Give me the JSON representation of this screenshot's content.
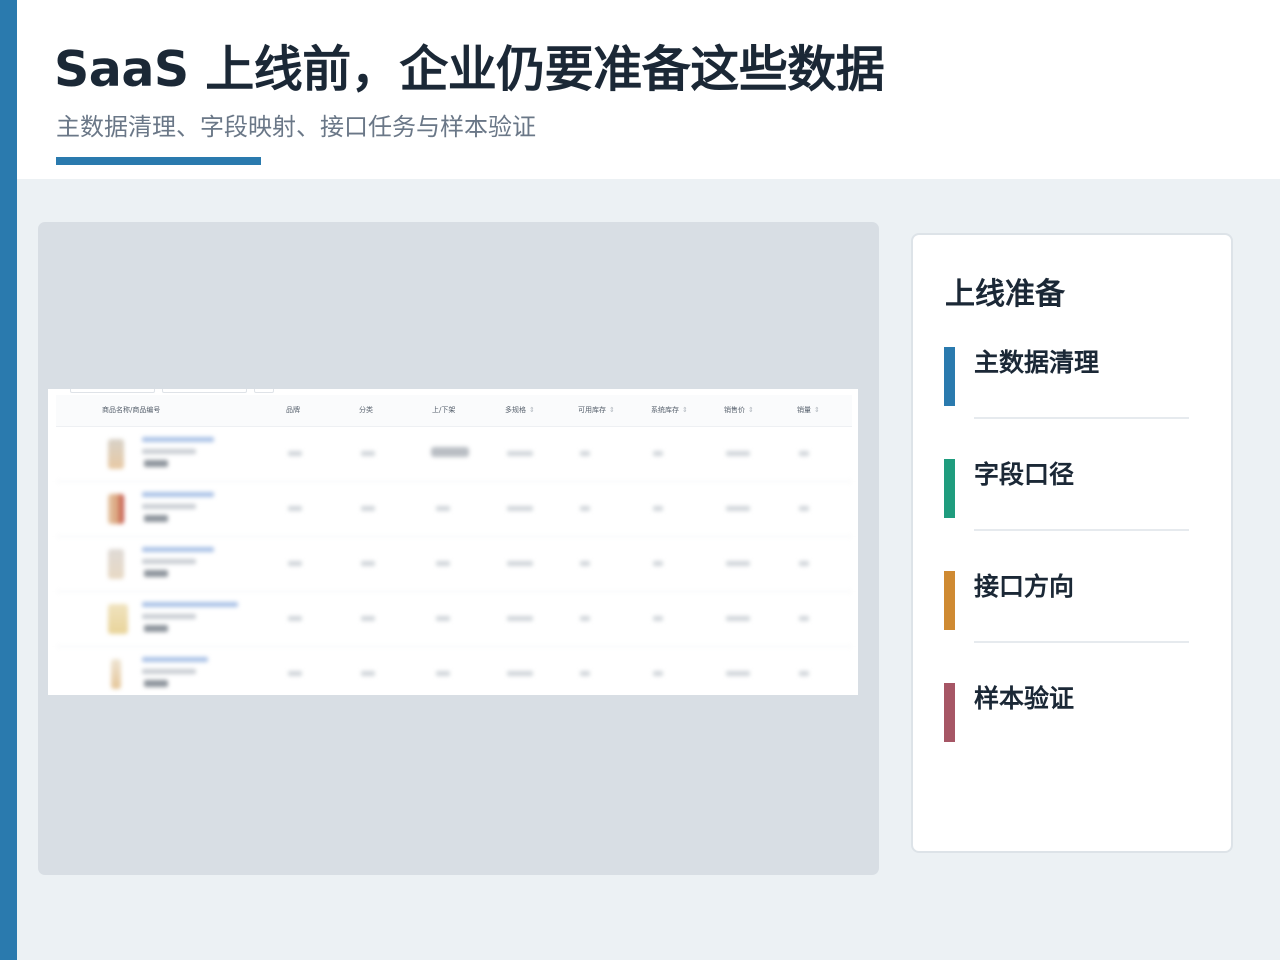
{
  "header": {
    "title": "SaaS 上线前，企业仍要准备这些数据",
    "subtitle": "主数据清理、字段映射、接口任务与样本验证",
    "accent_color": "#2a7aae"
  },
  "screenshot": {
    "columns": [
      {
        "label": "商品名称/商品编号",
        "sortable": false
      },
      {
        "label": "品牌",
        "sortable": false
      },
      {
        "label": "分类",
        "sortable": false
      },
      {
        "label": "上/下架",
        "sortable": false
      },
      {
        "label": "多规格",
        "sortable": true
      },
      {
        "label": "可用库存",
        "sortable": true
      },
      {
        "label": "系统库存",
        "sortable": true
      },
      {
        "label": "销售价",
        "sortable": true
      },
      {
        "label": "销量",
        "sortable": true
      }
    ],
    "row_count": 5,
    "content_blurred": true
  },
  "side_panel": {
    "title": "上线准备",
    "items": [
      {
        "label": "主数据清理",
        "color": "#2a7aae"
      },
      {
        "label": "字段口径",
        "color": "#1f9c7e"
      },
      {
        "label": "接口方向",
        "color": "#cf8a32"
      },
      {
        "label": "样本验证",
        "color": "#a65665"
      }
    ]
  },
  "icons": {
    "sort": "sort-arrows-icon"
  }
}
